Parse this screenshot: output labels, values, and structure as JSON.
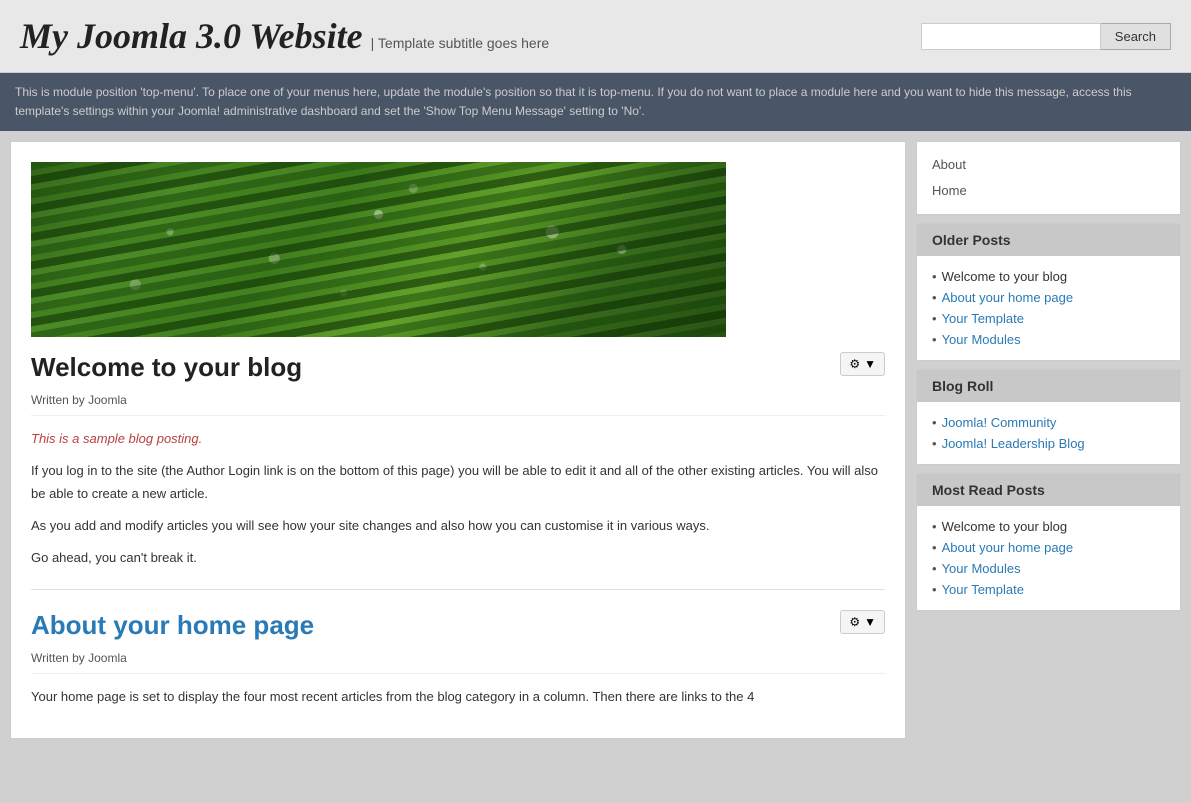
{
  "header": {
    "site_title": "My Joomla 3.0 Website",
    "site_subtitle": "| Template subtitle goes here",
    "search_placeholder": "",
    "search_button_label": "Search"
  },
  "top_menu": {
    "message": "This is module position 'top-menu'. To place one of your menus here, update the module's position so that it is top-menu. If you do not want to place a module here and you want to hide this message, access this template's settings within your Joomla! administrative dashboard and set the 'Show Top Menu Message' setting to 'No'."
  },
  "sidebar": {
    "nav_links": [
      {
        "label": "About",
        "href": "#"
      },
      {
        "label": "Home",
        "href": "#"
      }
    ],
    "older_posts": {
      "title": "Older Posts",
      "items": [
        {
          "label": "Welcome to your blog",
          "href": "#",
          "plain": true
        },
        {
          "label": "About your home page",
          "href": "#",
          "plain": false
        },
        {
          "label": "Your Template",
          "href": "#",
          "plain": false
        },
        {
          "label": "Your Modules",
          "href": "#",
          "plain": false
        }
      ]
    },
    "blog_roll": {
      "title": "Blog Roll",
      "items": [
        {
          "label": "Joomla! Community",
          "href": "#"
        },
        {
          "label": "Joomla! Leadership Blog",
          "href": "#"
        }
      ]
    },
    "most_read": {
      "title": "Most Read Posts",
      "items": [
        {
          "label": "Welcome to your blog",
          "href": "#",
          "plain": true
        },
        {
          "label": "About your home page",
          "href": "#",
          "plain": false
        },
        {
          "label": "Your Modules",
          "href": "#",
          "plain": false
        },
        {
          "label": "Your Template",
          "href": "#",
          "plain": false
        }
      ]
    }
  },
  "articles": [
    {
      "title": "Welcome to your blog",
      "title_link": false,
      "meta": "Written by Joomla",
      "body_lines": [
        {
          "type": "italic-red",
          "text": "This is a sample blog posting."
        },
        {
          "type": "normal",
          "text": "If you log in to the site (the Author Login link is on the bottom of this page) you will be able to edit it and all of the other existing articles. You will also be able to create a new article."
        },
        {
          "type": "normal",
          "text": "As you add and modify articles you will see how your site changes and also how you can customise it in various ways."
        },
        {
          "type": "normal",
          "text": "Go ahead, you can't break it."
        }
      ]
    },
    {
      "title": "About your home page",
      "title_link": true,
      "meta": "Written by Joomla",
      "body_lines": [
        {
          "type": "normal",
          "text": "Your home page is set to display the four most recent articles from the blog category in a column. Then there are links to the 4"
        }
      ]
    }
  ],
  "gear_btn": {
    "icon": "⚙",
    "dropdown": "▼"
  }
}
